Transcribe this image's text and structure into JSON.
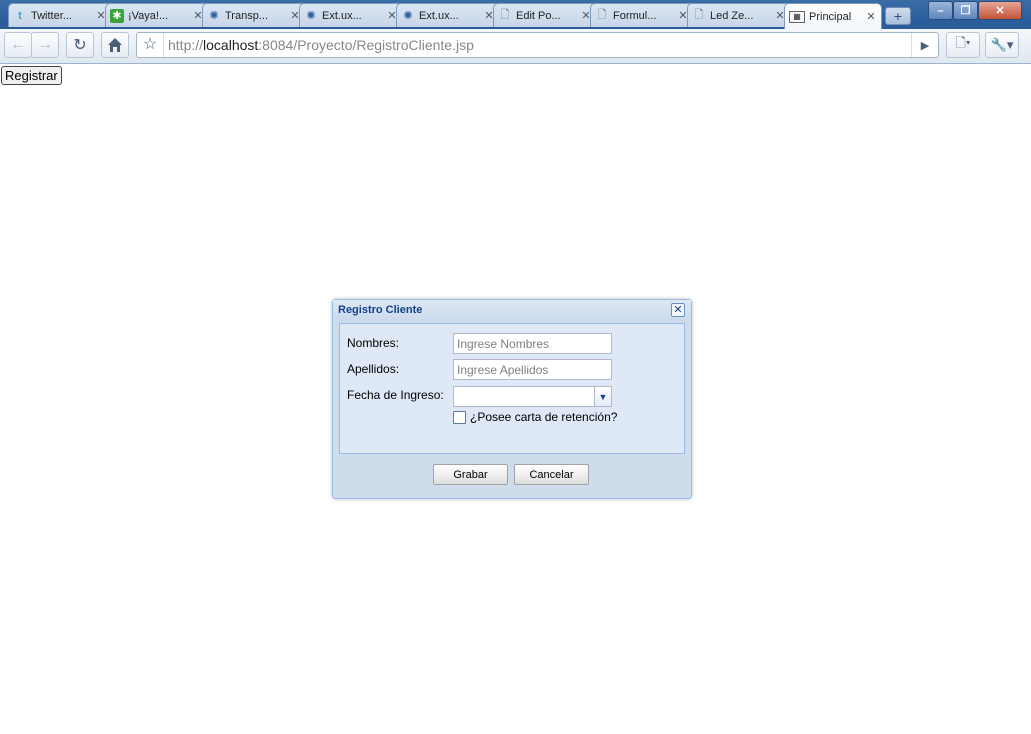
{
  "browser": {
    "tabs": [
      {
        "title": "Twitter...",
        "icon": "twitter-icon",
        "active": false
      },
      {
        "title": "¡Vaya!...",
        "icon": "green-star-icon",
        "active": false
      },
      {
        "title": "Transp...",
        "icon": "ext-globe-icon",
        "active": false
      },
      {
        "title": "Ext.ux...",
        "icon": "ext-globe-icon",
        "active": false
      },
      {
        "title": "Ext.ux...",
        "icon": "ext-globe-icon",
        "active": false
      },
      {
        "title": "Edit Po...",
        "icon": "page-icon",
        "active": false
      },
      {
        "title": "Formul...",
        "icon": "page-icon",
        "active": false
      },
      {
        "title": "Led Ze...",
        "icon": "page-icon",
        "active": false
      },
      {
        "title": "Principal",
        "icon": "image-page-icon",
        "active": true
      }
    ],
    "tab_close": "✕",
    "new_tab": "+",
    "window_buttons": {
      "minimize": "–",
      "maximize": "❐",
      "close": "✕"
    },
    "url": {
      "scheme": "http://",
      "host": "localhost",
      "rest": ":8084/Proyecto/RegistroCliente.jsp"
    }
  },
  "page": {
    "registrar_label": "Registrar"
  },
  "dialog": {
    "title": "Registro Cliente",
    "close_glyph": "✕",
    "fields": {
      "nombres_label": "Nombres:",
      "nombres_placeholder": "Ingrese Nombres",
      "apellidos_label": "Apellidos:",
      "apellidos_placeholder": "Ingrese Apellidos",
      "fecha_label": "Fecha de Ingreso:",
      "fecha_value": "",
      "carta_label": "¿Posee carta de retención?",
      "carta_checked": false
    },
    "buttons": {
      "save": "Grabar",
      "cancel": "Cancelar"
    }
  },
  "colors": {
    "tabstrip": "#2b5f9e",
    "window_border": "#99bbe8",
    "title_text": "#15428b",
    "panel_bg": "#dfe8f6"
  }
}
